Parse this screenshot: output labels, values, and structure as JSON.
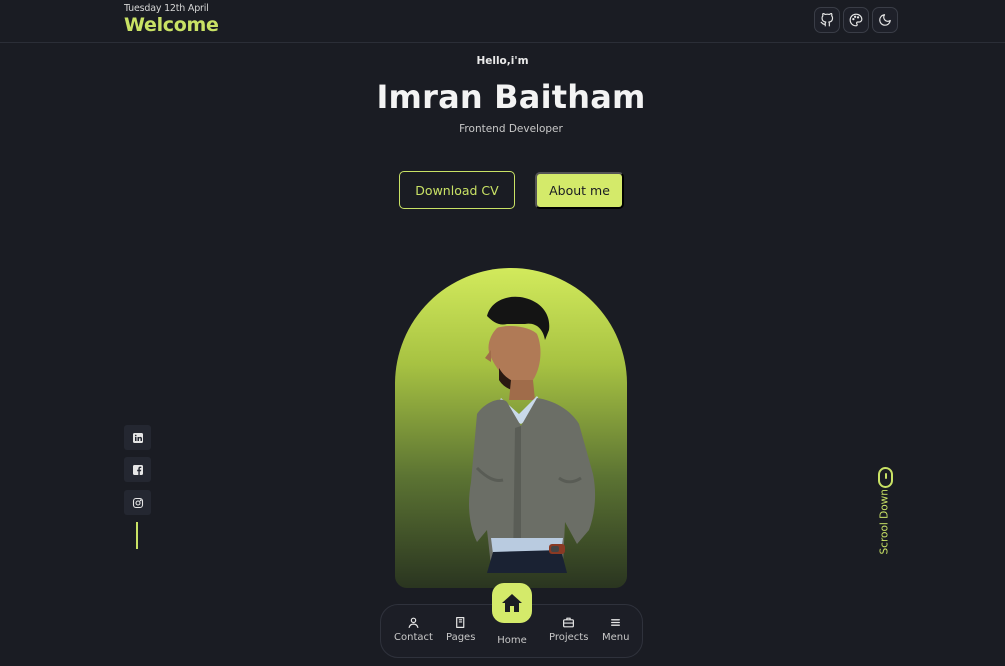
{
  "header": {
    "date": "Tuesday 12th April",
    "title": "Welcome",
    "buttons": [
      {
        "icon": "github-icon"
      },
      {
        "icon": "palette-icon"
      },
      {
        "icon": "moon-icon"
      }
    ]
  },
  "hero": {
    "greeting": "Hello,i'm",
    "name": "Imran Baitham",
    "role": "Frontend Developer",
    "download_label": "Download CV",
    "about_label": "About me"
  },
  "social": [
    {
      "icon": "linkedin-icon"
    },
    {
      "icon": "facebook-icon"
    },
    {
      "icon": "instagram-icon"
    }
  ],
  "scroll_label": "Scrool Down",
  "nav": {
    "items": [
      {
        "label": "Contact",
        "icon": "user-icon"
      },
      {
        "label": "Pages",
        "icon": "book-icon"
      },
      {
        "label": "Home",
        "icon": "home-icon"
      },
      {
        "label": "Projects",
        "icon": "briefcase-icon"
      },
      {
        "label": "Menu",
        "icon": "menu-icon"
      }
    ]
  },
  "colors": {
    "background": "#1a1c23",
    "accent": "#c9e265",
    "accent_fill": "#d4ea6a"
  }
}
